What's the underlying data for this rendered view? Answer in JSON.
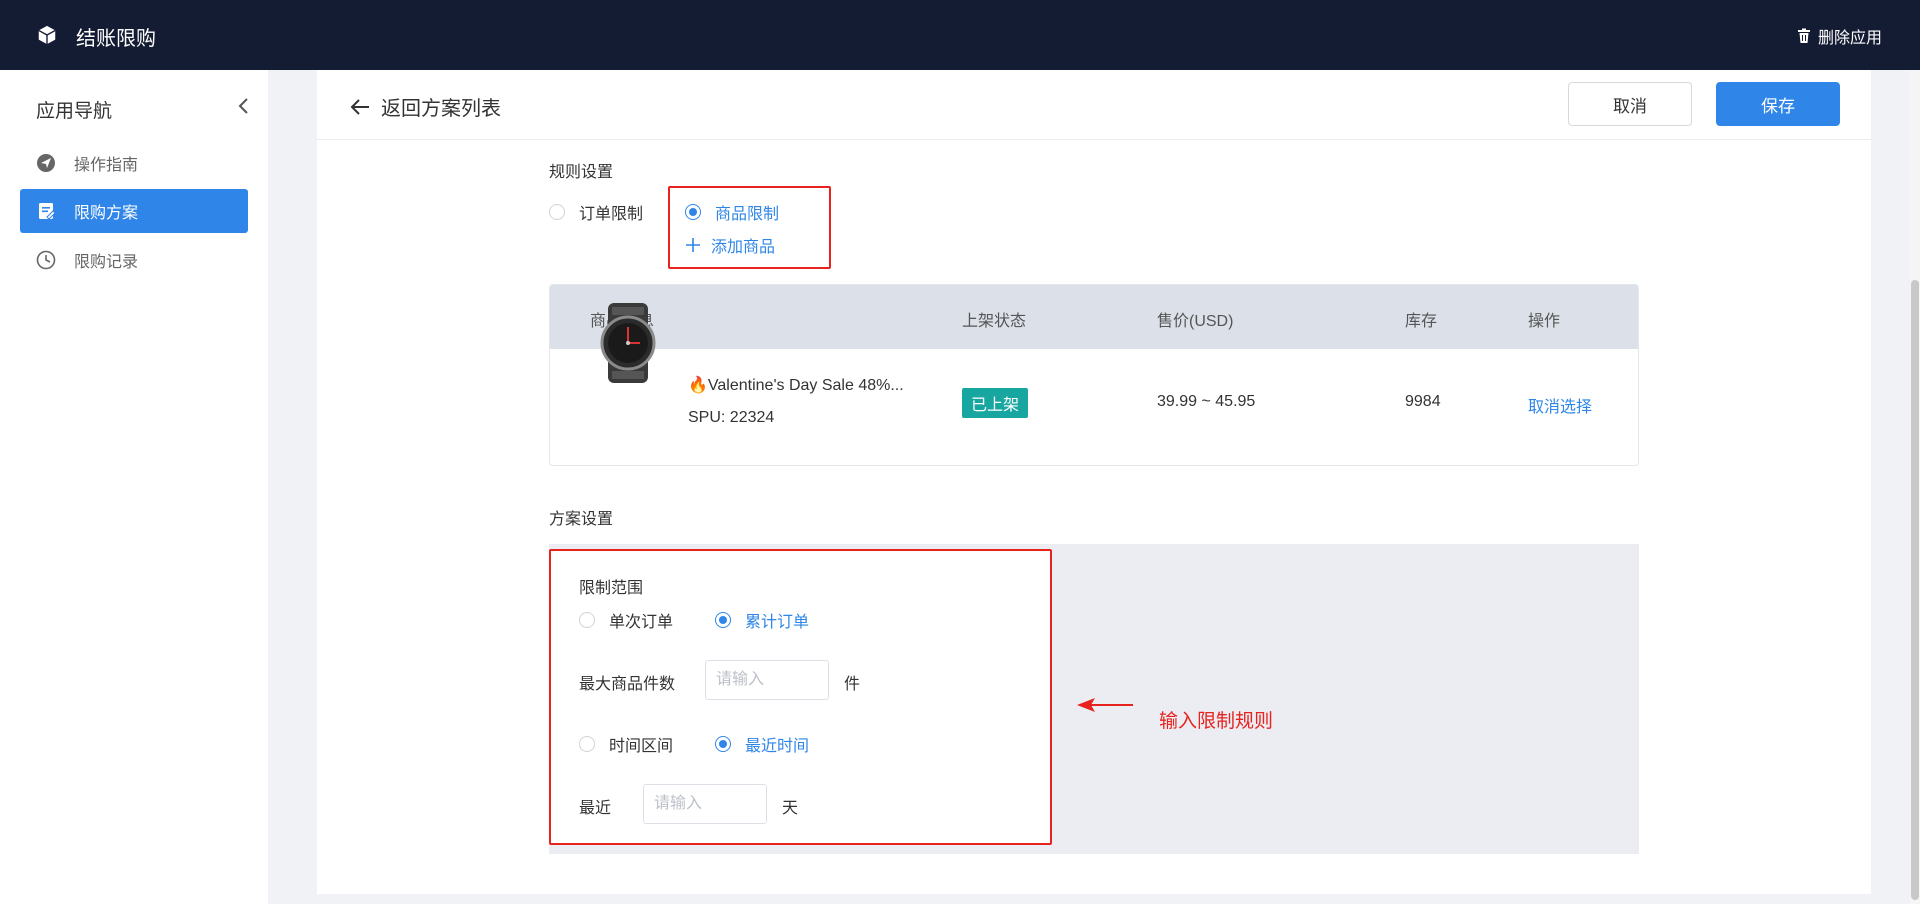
{
  "topbar": {
    "app_title": "结账限购",
    "delete_app_label": "删除应用"
  },
  "sidebar": {
    "title": "应用导航",
    "items": [
      {
        "label": "操作指南",
        "icon": "navigation-icon"
      },
      {
        "label": "限购方案",
        "icon": "edit-document-icon",
        "active": true
      },
      {
        "label": "限购记录",
        "icon": "clock-icon"
      }
    ]
  },
  "header": {
    "back_label": "返回方案列表",
    "cancel_label": "取消",
    "save_label": "保存"
  },
  "rules": {
    "section_label": "规则设置",
    "options": [
      {
        "label": "订单限制",
        "checked": false
      },
      {
        "label": "商品限制",
        "checked": true
      }
    ],
    "add_product_label": "添加商品"
  },
  "table": {
    "columns": [
      "商品信息",
      "上架状态",
      "售价(USD)",
      "库存",
      "操作"
    ],
    "rows": [
      {
        "name": "🔥Valentine's Day Sale 48%...",
        "spu": "SPU: 22324",
        "status": "已上架",
        "price": "39.99 ~ 45.95",
        "stock": "9984",
        "action": "取消选择"
      }
    ]
  },
  "plan": {
    "section_label": "方案设置",
    "scope_label": "限制范围",
    "scope_options": [
      {
        "label": "单次订单",
        "checked": false
      },
      {
        "label": "累计订单",
        "checked": true
      }
    ],
    "max_qty_label": "最大商品件数",
    "max_qty_placeholder": "请输入",
    "max_qty_unit": "件",
    "time_options": [
      {
        "label": "时间区间",
        "checked": false
      },
      {
        "label": "最近时间",
        "checked": true
      }
    ],
    "recent_label": "最近",
    "recent_placeholder": "请输入",
    "recent_unit": "天"
  },
  "annotation": {
    "text": "输入限制规则"
  },
  "colors": {
    "topbar_bg": "#141c33",
    "accent": "#2f86e8",
    "badge_bg": "#17a6a0",
    "highlight": "#e8231f"
  }
}
